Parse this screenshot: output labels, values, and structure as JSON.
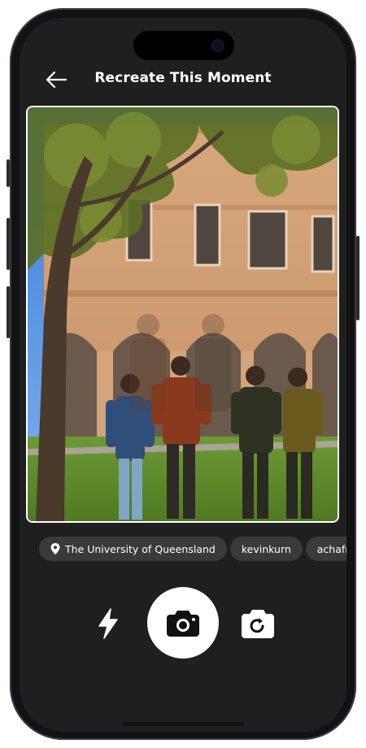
{
  "header": {
    "title": "Recreate This Moment",
    "back_icon": "arrow-left-icon"
  },
  "photo": {
    "description_icon": "group-photo-overlay"
  },
  "tags": [
    {
      "label": "The University of Queensland",
      "icon": "location-pin-icon"
    },
    {
      "label": "kevinkurn"
    },
    {
      "label": "achafriza"
    }
  ],
  "controls": {
    "flash_icon": "lightning-bolt-icon",
    "shutter_icon": "camera-icon",
    "flip_icon": "switch-camera-icon"
  },
  "colors": {
    "background": "#1f1f1f",
    "chip": "#3a3a3a",
    "text": "#ffffff",
    "shutter": "#ffffff"
  }
}
